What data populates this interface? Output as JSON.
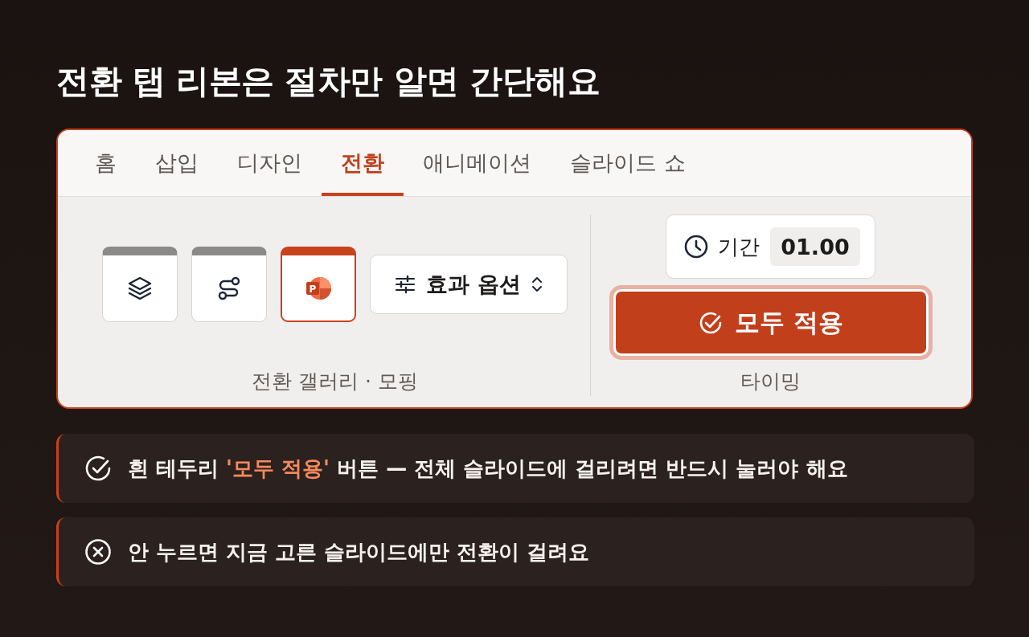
{
  "title": "전환 탭 리본은 절차만 알면 간단해요",
  "ribbon": {
    "tabs": [
      {
        "label": "홈",
        "selected": false
      },
      {
        "label": "삽입",
        "selected": false
      },
      {
        "label": "디자인",
        "selected": false
      },
      {
        "label": "전환",
        "selected": true
      },
      {
        "label": "애니메이션",
        "selected": false
      },
      {
        "label": "슬라이드 쇼",
        "selected": false
      }
    ],
    "gallery": {
      "thumbnails": [
        {
          "kind": "layers",
          "selected": false
        },
        {
          "kind": "route",
          "selected": false
        },
        {
          "kind": "app-logo",
          "logo_text": "P",
          "selected": true
        }
      ],
      "effect_options": {
        "label": "효과 옵션"
      },
      "group_label": "전환 갤러리 · 모핑"
    },
    "timing": {
      "duration": {
        "label": "기간",
        "value": "01.00"
      },
      "apply_all": {
        "label": "모두 적용",
        "focused": true
      },
      "group_label": "타이밍"
    }
  },
  "notes": [
    {
      "kind": "check",
      "text": "흰 테두리 **'모두 적용'** 버튼 — 전체 슬라이드에 걸리려면 반드시 눌러야 해요"
    },
    {
      "kind": "cross",
      "text": "안 누르면 지금 고른 슬라이드에만 전환이 걸려요"
    }
  ]
}
